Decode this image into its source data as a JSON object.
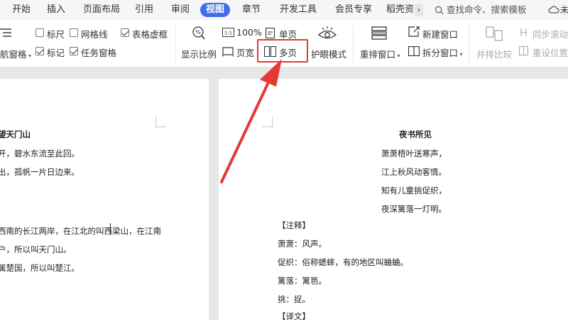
{
  "menubar": {
    "items": [
      "开始",
      "插入",
      "页面布局",
      "引用",
      "审阅",
      "视图",
      "章节",
      "开发工具",
      "会员专享",
      "稻壳资"
    ],
    "active": "视图",
    "search_placeholder": "查找命令、搜索模板",
    "account_label": "未"
  },
  "ribbon": {
    "nav_pane_label": "航窗格",
    "ruler_label": "标尺",
    "gridlines_label": "网格线",
    "table_gridlines_label": "表格虚框",
    "marks_label": "标记",
    "task_pane_label": "任务窗格",
    "zoom_label": "显示比例",
    "zoom_100_label": "100%",
    "page_width_label": "页宽",
    "single_page_label": "单页",
    "multi_page_label": "多页",
    "eye_mode_label": "护眼模式",
    "rearrange_label": "重排窗口",
    "new_window_label": "新建窗口",
    "split_window_label": "拆分窗口",
    "side_by_side_label": "并排比较",
    "sync_scroll_label": "同步滚动",
    "reset_position_label": "重设位置",
    "checkbox_states": {
      "ruler": false,
      "gridlines": false,
      "table_gridlines": true,
      "marks": true,
      "task_pane": true
    },
    "accent_color": "#3f6ee8",
    "highlight_color": "#e53935"
  },
  "left_page": {
    "lines": [
      "望天门山",
      "开，碧水东流至此回。",
      "出，孤帆一片日边来。",
      "西南的长江两岸，在江北的叫西梁山，在江南",
      "户，所以叫天门山。",
      "属楚国，所以叫楚江。"
    ]
  },
  "right_page": {
    "title": "夜书所见",
    "poem": [
      "萧萧梧叶送寒声，",
      "江上秋风动客情。",
      "知有儿童挑促织，",
      "夜深篱落一灯明。"
    ],
    "notes_header": "【注释】",
    "notes": [
      "萧萧：风声。",
      "促织：俗称蟋蟀，有的地区叫蛐蛐。",
      "篱落：篱笆。",
      "挑：捉。"
    ],
    "translation_header": "【译文】"
  }
}
